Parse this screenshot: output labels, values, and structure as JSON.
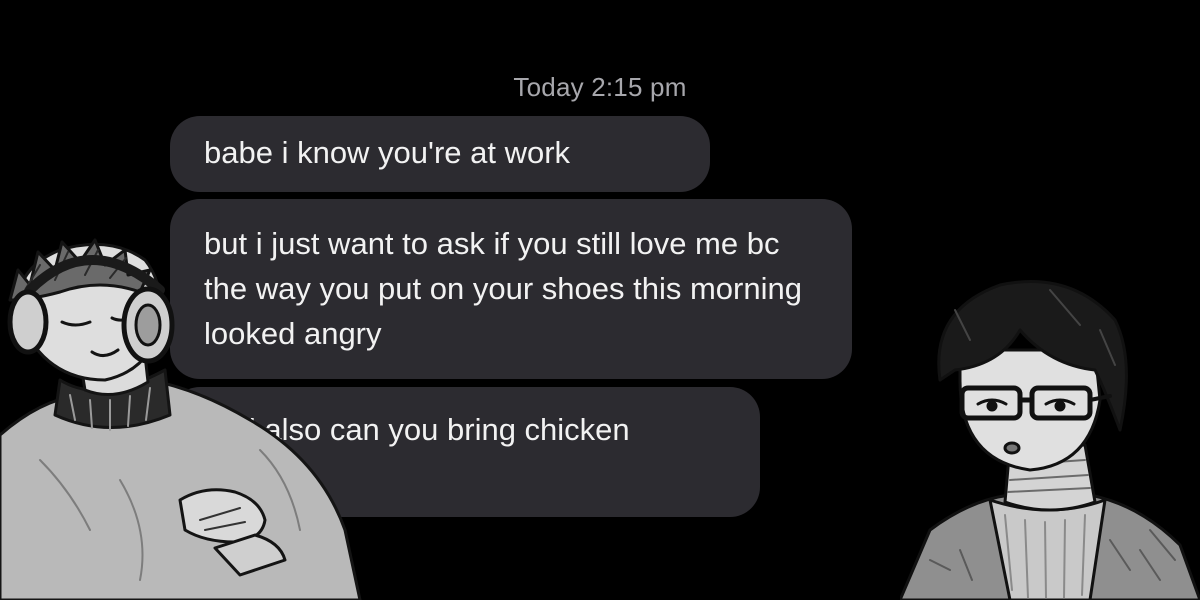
{
  "conversation": {
    "timestamp": "Today 2:15 pm",
    "messages": [
      {
        "text": "babe i know you're at work"
      },
      {
        "text": "but i just want to ask if you still love me bc the way you put on your shoes this morning looked angry"
      },
      {
        "text": "and also can you bring chicken nuggets"
      }
    ]
  },
  "characters": {
    "left": {
      "icon": "headphones-boy-drawing"
    },
    "right": {
      "icon": "glasses-boy-drawing"
    }
  },
  "colors": {
    "background": "#000000",
    "bubble": "#2c2b30",
    "text": "#f2f2f2",
    "timestamp": "#a7a7ac"
  }
}
